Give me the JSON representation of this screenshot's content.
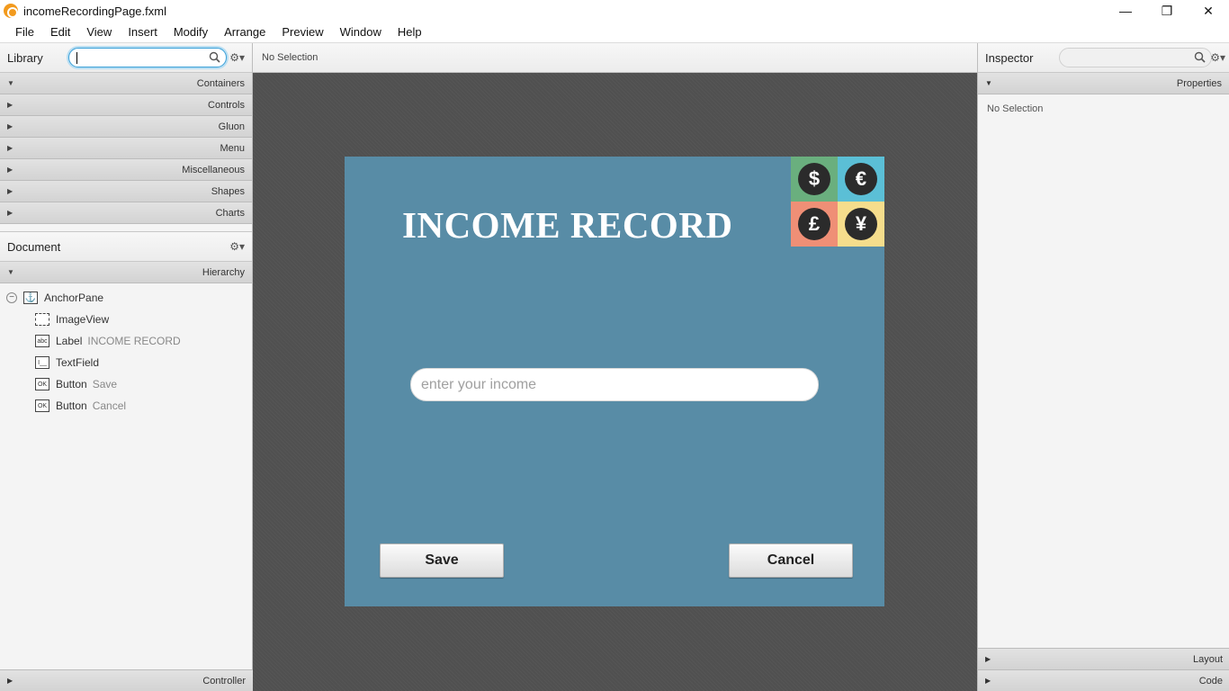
{
  "window": {
    "title": "incomeRecordingPage.fxml",
    "controls": {
      "minimize": "—",
      "restore": "❐",
      "close": "✕"
    }
  },
  "menu": [
    "File",
    "Edit",
    "View",
    "Insert",
    "Modify",
    "Arrange",
    "Preview",
    "Window",
    "Help"
  ],
  "library": {
    "title": "Library",
    "search_value": "",
    "sections": [
      {
        "label": "Containers",
        "arrow": "▼"
      },
      {
        "label": "Controls",
        "arrow": "▶"
      },
      {
        "label": "Gluon",
        "arrow": "▶"
      },
      {
        "label": "Menu",
        "arrow": "▶"
      },
      {
        "label": "Miscellaneous",
        "arrow": "▶"
      },
      {
        "label": "Shapes",
        "arrow": "▶"
      },
      {
        "label": "Charts",
        "arrow": "▶"
      }
    ]
  },
  "document": {
    "title": "Document",
    "hierarchy_label": "Hierarchy",
    "tree": [
      {
        "type": "AnchorPane",
        "hint": "",
        "icon": "⚓"
      },
      {
        "type": "ImageView",
        "hint": "",
        "icon": ""
      },
      {
        "type": "Label",
        "hint": "INCOME RECORD",
        "icon": "abc"
      },
      {
        "type": "TextField",
        "hint": "",
        "icon": "I__"
      },
      {
        "type": "Button",
        "hint": "Save",
        "icon": "OK"
      },
      {
        "type": "Button",
        "hint": "Cancel",
        "icon": "OK"
      }
    ],
    "controller_label": "Controller"
  },
  "center": {
    "selection_status": "No Selection"
  },
  "form": {
    "title": "INCOME RECORD",
    "input_placeholder": "enter your income",
    "input_value": "",
    "save_label": "Save",
    "cancel_label": "Cancel",
    "background": "#588ca6",
    "currencies": [
      {
        "symbol": "$",
        "color": "#6aaf7e"
      },
      {
        "symbol": "€",
        "color": "#5bbfd6"
      },
      {
        "symbol": "£",
        "color": "#ef8f76"
      },
      {
        "symbol": "¥",
        "color": "#f5dd8c"
      }
    ]
  },
  "inspector": {
    "title": "Inspector",
    "properties_label": "Properties",
    "no_selection": "No Selection",
    "layout_label": "Layout",
    "code_label": "Code"
  }
}
